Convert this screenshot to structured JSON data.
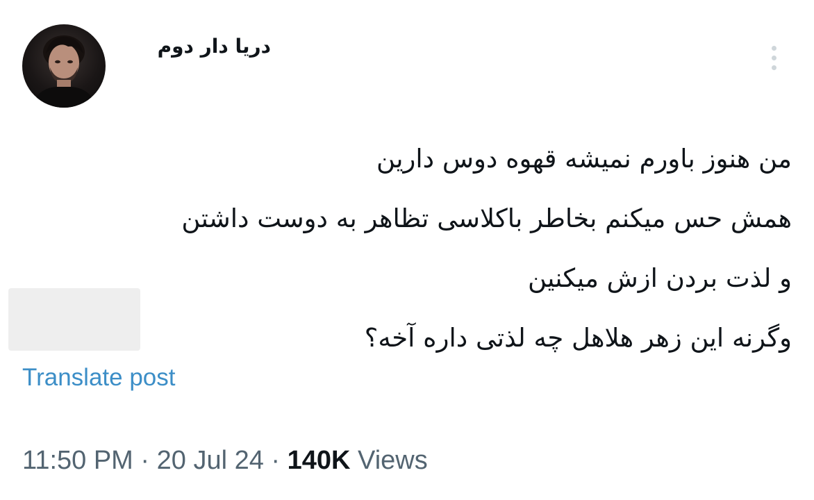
{
  "author": {
    "display_name": "دریا دار دوم",
    "avatar_icon": "person-photo-avatar"
  },
  "menu": {
    "icon": "more-vertical-icon"
  },
  "tweet": {
    "lines": [
      "من هنوز باورم نمیشه قهوه دوس دارین",
      "همش حس میکنم بخاطر باکلاسی تظاهر به دوست داشتن",
      "و لذت بردن ازش میکنین",
      "وگرنه این زهر هلاهل چه لذتی داره آخه؟"
    ]
  },
  "translate_label": "Translate post",
  "meta": {
    "time": "11:50 PM",
    "separator": " · ",
    "date": "20 Jul 24",
    "views_count": "140K",
    "views_label": " Views"
  },
  "colors": {
    "text": "#0f1419",
    "secondary": "#536471",
    "link": "#3c8ec7",
    "menu_dots": "#cfd6da"
  }
}
